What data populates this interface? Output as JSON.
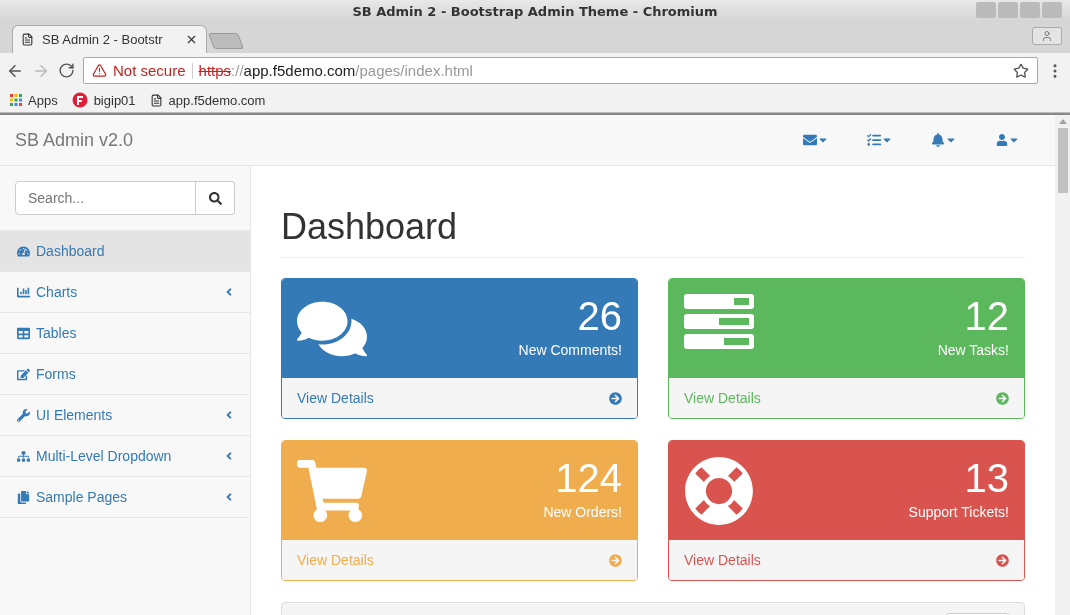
{
  "window": {
    "title": "SB Admin 2 - Bootstrap Admin Theme - Chromium"
  },
  "tabs": [
    {
      "label": "SB Admin 2 - Bootstr",
      "selected": true
    }
  ],
  "address_bar": {
    "security": "Not secure",
    "scheme": "https",
    "separator": "://",
    "host": "app.f5demo.com",
    "path": "/pages/index.html"
  },
  "bookmarks": [
    {
      "label": "Apps"
    },
    {
      "label": "bigip01"
    },
    {
      "label": "app.f5demo.com"
    }
  ],
  "navbar": {
    "brand": "SB Admin v2.0"
  },
  "sidebar": {
    "search": {
      "placeholder": "Search..."
    },
    "items": [
      {
        "label": "Dashboard",
        "selected": true,
        "has_submenu": false
      },
      {
        "label": "Charts",
        "selected": false,
        "has_submenu": true
      },
      {
        "label": "Tables",
        "selected": false,
        "has_submenu": false
      },
      {
        "label": "Forms",
        "selected": false,
        "has_submenu": false
      },
      {
        "label": "UI Elements",
        "selected": false,
        "has_submenu": true
      },
      {
        "label": "Multi-Level Dropdown",
        "selected": false,
        "has_submenu": true
      },
      {
        "label": "Sample Pages",
        "selected": false,
        "has_submenu": true
      }
    ]
  },
  "page_title": "Dashboard",
  "panels": [
    {
      "count": "26",
      "label": "New Comments!",
      "link": "View Details",
      "color": "#337ab7"
    },
    {
      "count": "12",
      "label": "New Tasks!",
      "link": "View Details",
      "color": "#5cb85c"
    },
    {
      "count": "124",
      "label": "New Orders!",
      "link": "View Details",
      "color": "#f0ad4e"
    },
    {
      "count": "13",
      "label": "Support Tickets!",
      "link": "View Details",
      "color": "#d9534f"
    }
  ]
}
